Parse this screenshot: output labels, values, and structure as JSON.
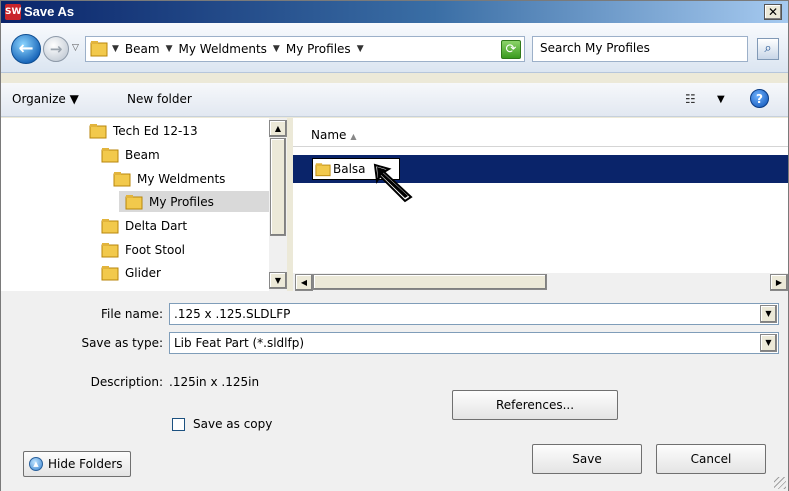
{
  "window": {
    "title": "Save As",
    "app_icon": "solidworks-icon",
    "close_label": "✕"
  },
  "address": {
    "breadcrumb": [
      "Beam",
      "My Weldments",
      "My Profiles"
    ],
    "search_placeholder": "Search My Profiles"
  },
  "toolbar": {
    "organize_label": "Organize ▼",
    "new_folder_label": "New folder",
    "views_icon": "☷",
    "help_icon": "?"
  },
  "tree": {
    "items": [
      {
        "label": "Tech Ed 12-13"
      },
      {
        "label": "Beam"
      },
      {
        "label": "My Weldments"
      },
      {
        "label": "My Profiles",
        "selected": true
      },
      {
        "label": "Delta Dart"
      },
      {
        "label": "Foot Stool"
      },
      {
        "label": "Glider"
      }
    ]
  },
  "filelist": {
    "column_name": "Name",
    "editing_item": "Balsa"
  },
  "form": {
    "file_name_label": "File name:",
    "file_name_value": ".125 x .125.SLDLFP",
    "save_type_label": "Save as type:",
    "save_type_value": "Lib Feat Part (*.sldlfp)",
    "description_label": "Description:",
    "description_value": ".125in x .125in",
    "save_copy_label": "Save as copy",
    "references_label": "References...",
    "save_label": "Save",
    "cancel_label": "Cancel",
    "hide_folders_label": "Hide Folders"
  },
  "colors": {
    "selection": "#0a246a",
    "folder": "#f2c94c",
    "accent": "#1764b8"
  }
}
